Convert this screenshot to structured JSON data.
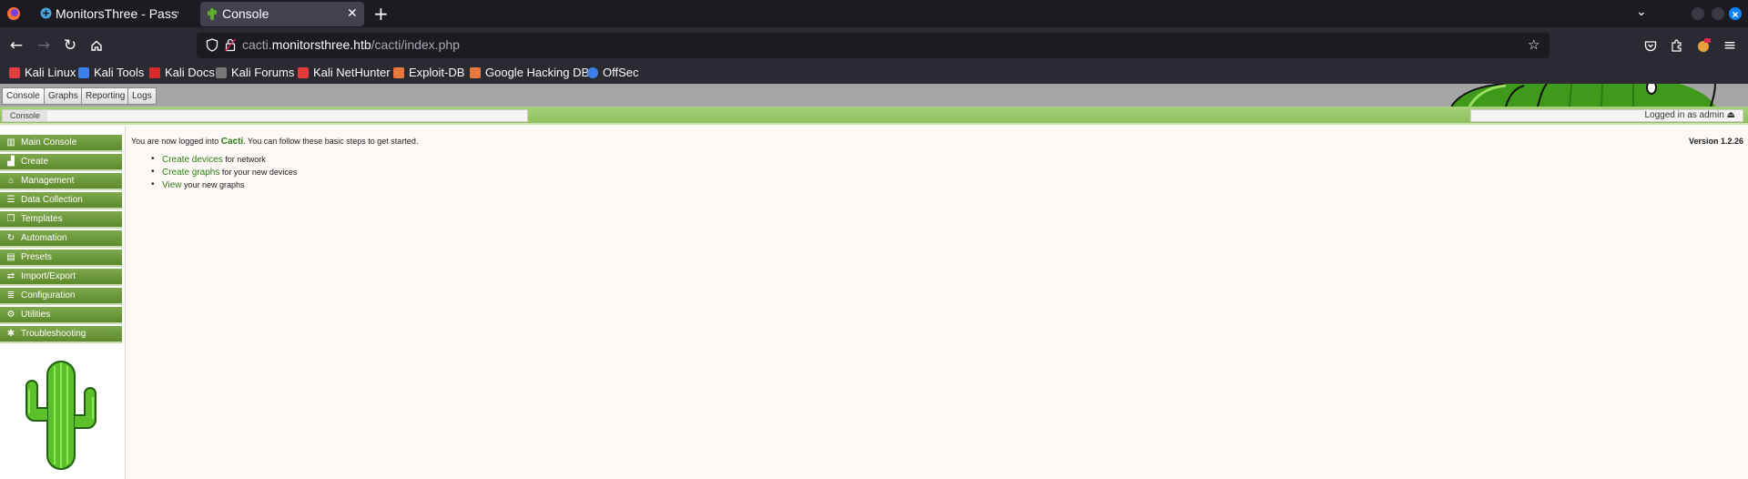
{
  "browser": {
    "tabs": [
      {
        "title": "MonitorsThree - Passwor",
        "active": false
      },
      {
        "title": "Console",
        "active": true
      }
    ],
    "url": {
      "pre": "cacti.",
      "host": "monitorsthree.htb",
      "path": "/cacti/index.php"
    },
    "bookmarks": [
      {
        "label": "Kali Linux",
        "color": "#e33c3c"
      },
      {
        "label": "Kali Tools",
        "color": "#3d7ee8"
      },
      {
        "label": "Kali Docs",
        "color": "#d92b2b"
      },
      {
        "label": "Kali Forums",
        "color": "#777777"
      },
      {
        "label": "Kali NetHunter",
        "color": "#e33c3c"
      },
      {
        "label": "Exploit-DB",
        "color": "#e8793d"
      },
      {
        "label": "Google Hacking DB",
        "color": "#e8793d"
      },
      {
        "label": "OffSec",
        "color": "#3d7ee8"
      }
    ]
  },
  "cacti": {
    "top_tabs": [
      "Console",
      "Graphs",
      "Reporting",
      "Logs"
    ],
    "breadcrumb": "Console",
    "user_status": "Logged in as admin ⏏",
    "menu": [
      {
        "label": "Main Console",
        "icon": "map-icon"
      },
      {
        "label": "Create",
        "icon": "chart-icon"
      },
      {
        "label": "Management",
        "icon": "home-icon"
      },
      {
        "label": "Data Collection",
        "icon": "database-icon"
      },
      {
        "label": "Templates",
        "icon": "copy-icon"
      },
      {
        "label": "Automation",
        "icon": "sync-icon"
      },
      {
        "label": "Presets",
        "icon": "archive-icon"
      },
      {
        "label": "Import/Export",
        "icon": "exchange-icon"
      },
      {
        "label": "Configuration",
        "icon": "sliders-icon"
      },
      {
        "label": "Utilities",
        "icon": "cogs-icon"
      },
      {
        "label": "Troubleshooting",
        "icon": "bug-icon"
      }
    ],
    "intro": {
      "before": "You are now logged into ",
      "brand": "Cacti",
      "after": ". You can follow these basic steps to get started."
    },
    "steps": [
      {
        "link": "Create devices",
        "rest": " for network"
      },
      {
        "link": "Create graphs",
        "rest": " for your new devices"
      },
      {
        "link": "View",
        "rest": " your new graphs"
      }
    ],
    "version": "Version 1.2.26"
  }
}
